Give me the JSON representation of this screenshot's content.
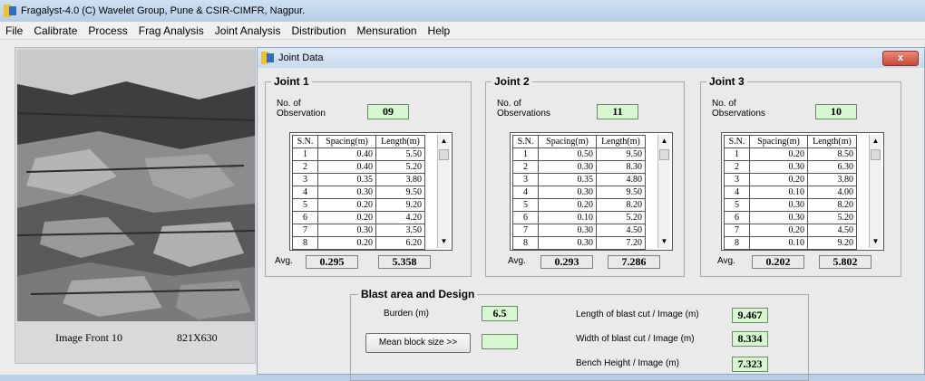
{
  "app": {
    "title": "Fragalyst-4.0 (C) Wavelet Group, Pune & CSIR-CIMFR, Nagpur."
  },
  "menu": [
    "File",
    "Calibrate",
    "Process",
    "Frag Analysis",
    "Joint Analysis",
    "Distribution",
    "Mensuration",
    "Help"
  ],
  "image_panel": {
    "name": "Image Front 10",
    "size": "821X630"
  },
  "dialog": {
    "title": "Joint Data",
    "close_label": "x"
  },
  "grid_headers": {
    "sn": "S.N.",
    "spacing": "Spacing(m)",
    "length": "Length(m)"
  },
  "avg_label": "Avg.",
  "joints": [
    {
      "title": "Joint 1",
      "obs_label": "No. of\nObservation",
      "obs_count": "09",
      "rows": [
        [
          "1",
          "0.40",
          "5.50"
        ],
        [
          "2",
          "0.40",
          "5.20"
        ],
        [
          "3",
          "0.35",
          "3.80"
        ],
        [
          "4",
          "0.30",
          "9.50"
        ],
        [
          "5",
          "0.20",
          "9.20"
        ],
        [
          "6",
          "0.20",
          "4.20"
        ],
        [
          "7",
          "0.30",
          "3.50"
        ],
        [
          "8",
          "0.20",
          "6.20"
        ]
      ],
      "avg_spacing": "0.295",
      "avg_length": "5.358"
    },
    {
      "title": "Joint 2",
      "obs_label": "No. of\nObservations",
      "obs_count": "11",
      "rows": [
        [
          "1",
          "0.50",
          "9.50"
        ],
        [
          "2",
          "0.30",
          "8.30"
        ],
        [
          "3",
          "0.35",
          "4.80"
        ],
        [
          "4",
          "0.30",
          "9.50"
        ],
        [
          "5",
          "0.20",
          "8.20"
        ],
        [
          "6",
          "0.10",
          "5.20"
        ],
        [
          "7",
          "0.30",
          "4.50"
        ],
        [
          "8",
          "0.30",
          "7.20"
        ]
      ],
      "avg_spacing": "0.293",
      "avg_length": "7.286"
    },
    {
      "title": "Joint 3",
      "obs_label": "No. of\nObservations",
      "obs_count": "10",
      "rows": [
        [
          "1",
          "0.20",
          "8.50"
        ],
        [
          "2",
          "0.30",
          "6.30"
        ],
        [
          "3",
          "0.20",
          "3.80"
        ],
        [
          "4",
          "0.10",
          "4.00"
        ],
        [
          "5",
          "0.30",
          "8.20"
        ],
        [
          "6",
          "0.30",
          "5.20"
        ],
        [
          "7",
          "0.20",
          "4.50"
        ],
        [
          "8",
          "0.10",
          "9.20"
        ]
      ],
      "avg_spacing": "0.202",
      "avg_length": "5.802"
    }
  ],
  "blast": {
    "title": "Blast area and Design",
    "burden_label": "Burden (m)",
    "burden_value": "6.5",
    "mean_block_button": "Mean block size >>",
    "mean_block_value": "",
    "length_label": "Length of blast cut / Image (m)",
    "length_value": "9.467",
    "width_label": "Width of blast cut / Image (m)",
    "width_value": "8.334",
    "height_label": "Bench Height / Image (m)",
    "height_value": "7.323"
  },
  "colors": {
    "title_bar": "#c8daee",
    "green_field": "#d6f7cf",
    "close_button": "#c74a35"
  }
}
